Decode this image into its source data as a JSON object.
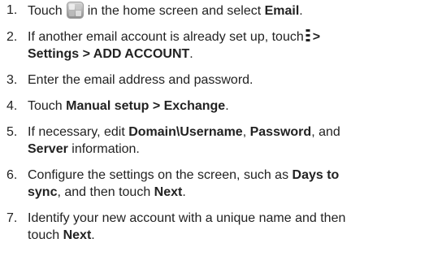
{
  "steps": [
    {
      "num": "1.",
      "parts": [
        {
          "t": "Touch"
        },
        {
          "icon": "home-screen-app-icon"
        },
        {
          "t": "in the home screen and select "
        },
        {
          "t": "Email",
          "b": true
        },
        {
          "t": "."
        }
      ]
    },
    {
      "num": "2.",
      "parts": [
        {
          "t": "If another email account is already set up, touch"
        },
        {
          "icon": "menu-dots-icon"
        },
        {
          "t": ">",
          "b": true
        },
        {
          "br": true
        },
        {
          "t": "Settings > ADD ACCOUNT",
          "b": true
        },
        {
          "t": "."
        }
      ]
    },
    {
      "num": "3.",
      "parts": [
        {
          "t": "Enter the email address and password."
        }
      ]
    },
    {
      "num": "4.",
      "parts": [
        {
          "t": "Touch "
        },
        {
          "t": "Manual setup > Exchange",
          "b": true
        },
        {
          "t": "."
        }
      ]
    },
    {
      "num": "5.",
      "parts": [
        {
          "t": "If necessary, edit "
        },
        {
          "t": "Domain\\Username",
          "b": true
        },
        {
          "t": ", "
        },
        {
          "t": "Password",
          "b": true
        },
        {
          "t": ", and"
        },
        {
          "br": true
        },
        {
          "t": "Server",
          "b": true
        },
        {
          "t": " information."
        }
      ]
    },
    {
      "num": "6.",
      "parts": [
        {
          "t": "Configure the settings on the screen, such as "
        },
        {
          "t": "Days to",
          "b": true
        },
        {
          "br": true
        },
        {
          "t": "sync",
          "b": true
        },
        {
          "t": ", and then touch "
        },
        {
          "t": "Next",
          "b": true
        },
        {
          "t": "."
        }
      ]
    },
    {
      "num": "7.",
      "parts": [
        {
          "t": "Identify your new account with a unique name and then"
        },
        {
          "br": true
        },
        {
          "t": "touch "
        },
        {
          "t": "Next",
          "b": true
        },
        {
          "t": "."
        }
      ]
    }
  ]
}
